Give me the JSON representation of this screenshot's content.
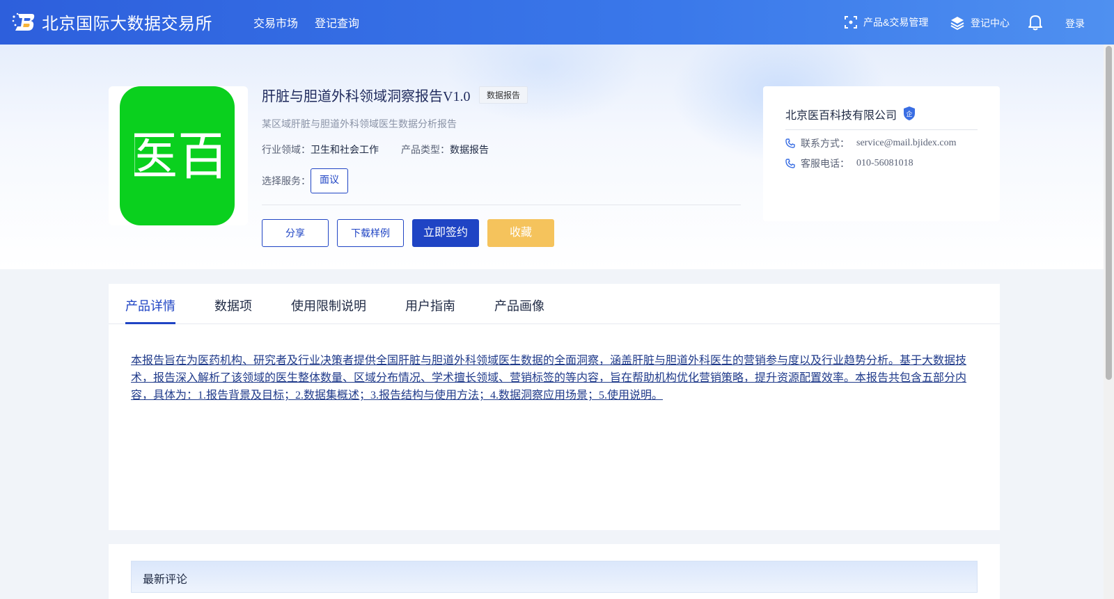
{
  "header": {
    "site_title": "北京国际大数据交易所",
    "nav": [
      "交易市场",
      "登记查询"
    ],
    "product_mgmt": "产品&交易管理",
    "registration_center": "登记中心",
    "login": "登录"
  },
  "product": {
    "logo_text": "医百",
    "title": "肝脏与胆道外科领域洞察报告V1.0",
    "badge": "数据报告",
    "description": "某区域肝脏与胆道外科领域医生数据分析报告",
    "industry_label": "行业领域：",
    "industry_value": "卫生和社会工作",
    "type_label": "产品类型：",
    "type_value": "数据报告",
    "service_label": "选择服务：",
    "service_option": "面议",
    "buttons": {
      "share": "分享",
      "download_sample": "下载样例",
      "sign_now": "立即签约",
      "favorite": "收藏"
    }
  },
  "company": {
    "name": "北京医百科技有限公司",
    "badge_char": "企",
    "contact_label": "联系方式：",
    "contact_value": "service@mail.bjidex.com",
    "phone_label": "客服电话：",
    "phone_value": "010-56081018"
  },
  "tabs": {
    "items": [
      "产品详情",
      "数据项",
      "使用限制说明",
      "用户指南",
      "产品画像"
    ],
    "active": 0
  },
  "detail_text": "本报告旨在为医药机构、研究者及行业决策者提供全国肝脏与胆道外科领域医生数据的全面洞察，涵盖肝脏与胆道外科医生的营销参与度以及行业趋势分析。基于大数据技术，报告深入解析了该领域的医生整体数量、区域分布情况、学术擅长领域、营销标签的等内容，旨在帮助机构优化营销策略，提升资源配置效率。本报告共包含五部分内容，具体为：1.报告背景及目标；2.数据集概述；3.报告结构与使用方法；4.数据洞察应用场景；5.使用说明。",
  "comments": {
    "title": "最新评论"
  },
  "colors": {
    "primary": "#1f44c4",
    "header_start": "#2d5fdc",
    "header_end": "#4f90f0",
    "favorite": "#f5c35c",
    "logo_green": "#0ad01e"
  }
}
